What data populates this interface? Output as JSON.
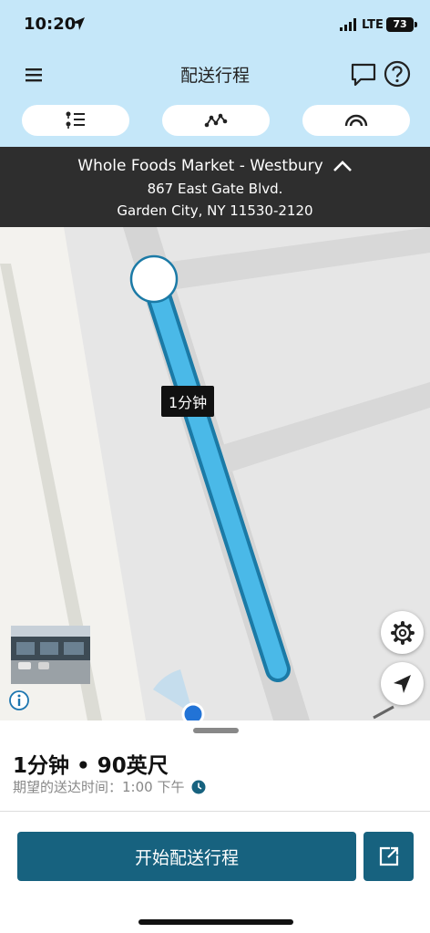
{
  "status_bar": {
    "time": "10:20",
    "network": "LTE",
    "battery": "73",
    "icons": [
      "location-arrow-icon",
      "signal-icon",
      "battery-icon"
    ]
  },
  "header": {
    "title": "配送行程",
    "icons": [
      "menu-icon",
      "chat-icon",
      "help-icon"
    ]
  },
  "view_pills": [
    "stop-list-icon",
    "route-icon",
    "signal-icon"
  ],
  "address": {
    "name": "Whole Foods Market - Westbury",
    "street": "867 East Gate Blvd.",
    "city": "Garden City, NY 11530-2120"
  },
  "map": {
    "eta_label": "1分钟",
    "route_color": "#4ab9e8",
    "icons": [
      "info-icon",
      "gear-icon",
      "navigation-arrow-icon"
    ]
  },
  "summary": {
    "headline": "1分钟 • 90英尺",
    "expected_label": "期望的送达时间：",
    "expected_time": "1:00 下午"
  },
  "actions": {
    "start_label": "开始配送行程",
    "accent_color": "#17627f"
  }
}
